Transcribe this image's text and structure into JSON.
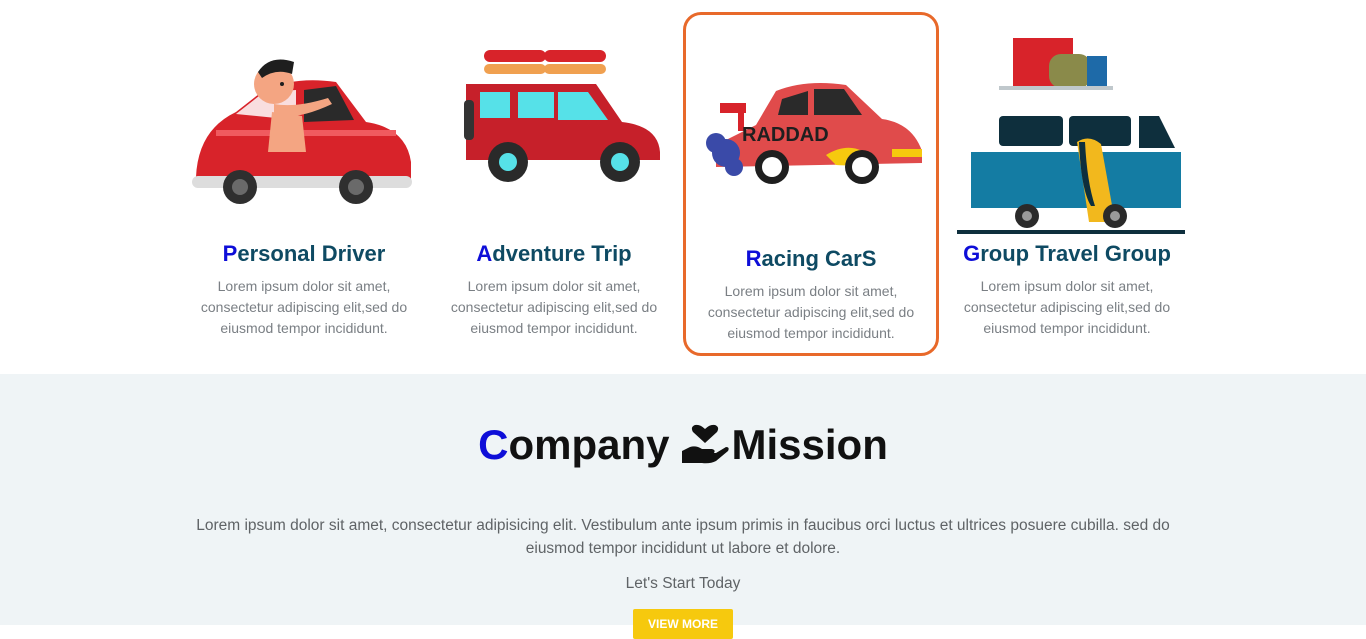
{
  "services": [
    {
      "first": "P",
      "rest": "ersonal Driver",
      "text": "Lorem ipsum dolor sit amet, consectetur adipiscing elit,sed do eiusmod tempor incididunt.",
      "icon": "red-car-driver-icon"
    },
    {
      "first": "A",
      "rest": "dventure Trip",
      "text": "Lorem ipsum dolor sit amet, consectetur adipiscing elit,sed do eiusmod tempor incididunt.",
      "icon": "jeep-with-kayaks-icon"
    },
    {
      "first": "R",
      "rest": "acing CarS",
      "text": "Lorem ipsum dolor sit amet, consectetur adipiscing elit,sed do eiusmod tempor incididunt.",
      "icon": "rad-dad-race-car-icon",
      "car_text": "RADDAD"
    },
    {
      "first": "G",
      "rest": "roup Travel Group",
      "text": "Lorem ipsum dolor sit amet, consectetur adipiscing elit,sed do eiusmod tempor incididunt.",
      "icon": "camper-van-icon"
    }
  ],
  "mission": {
    "title_first": "C",
    "title_rest": "ompany",
    "title_icon": "heart-in-hand-icon",
    "title_end": "Mission",
    "body": "Lorem ipsum dolor sit amet, consectetur adipisicing elit. Vestibulum ante ipsum primis in faucibus orci luctus et ultrices posuere cubilla. sed do eiusmod tempor incididunt ut labore et dolore.",
    "cta": "Let's Start Today",
    "button": "VIEW MORE"
  },
  "colors": {
    "accent": "#0e0ed8",
    "title": "#0e4a63",
    "active_border": "#e8692a",
    "button": "#f6c90e",
    "section_bg": "#eff4f6"
  }
}
